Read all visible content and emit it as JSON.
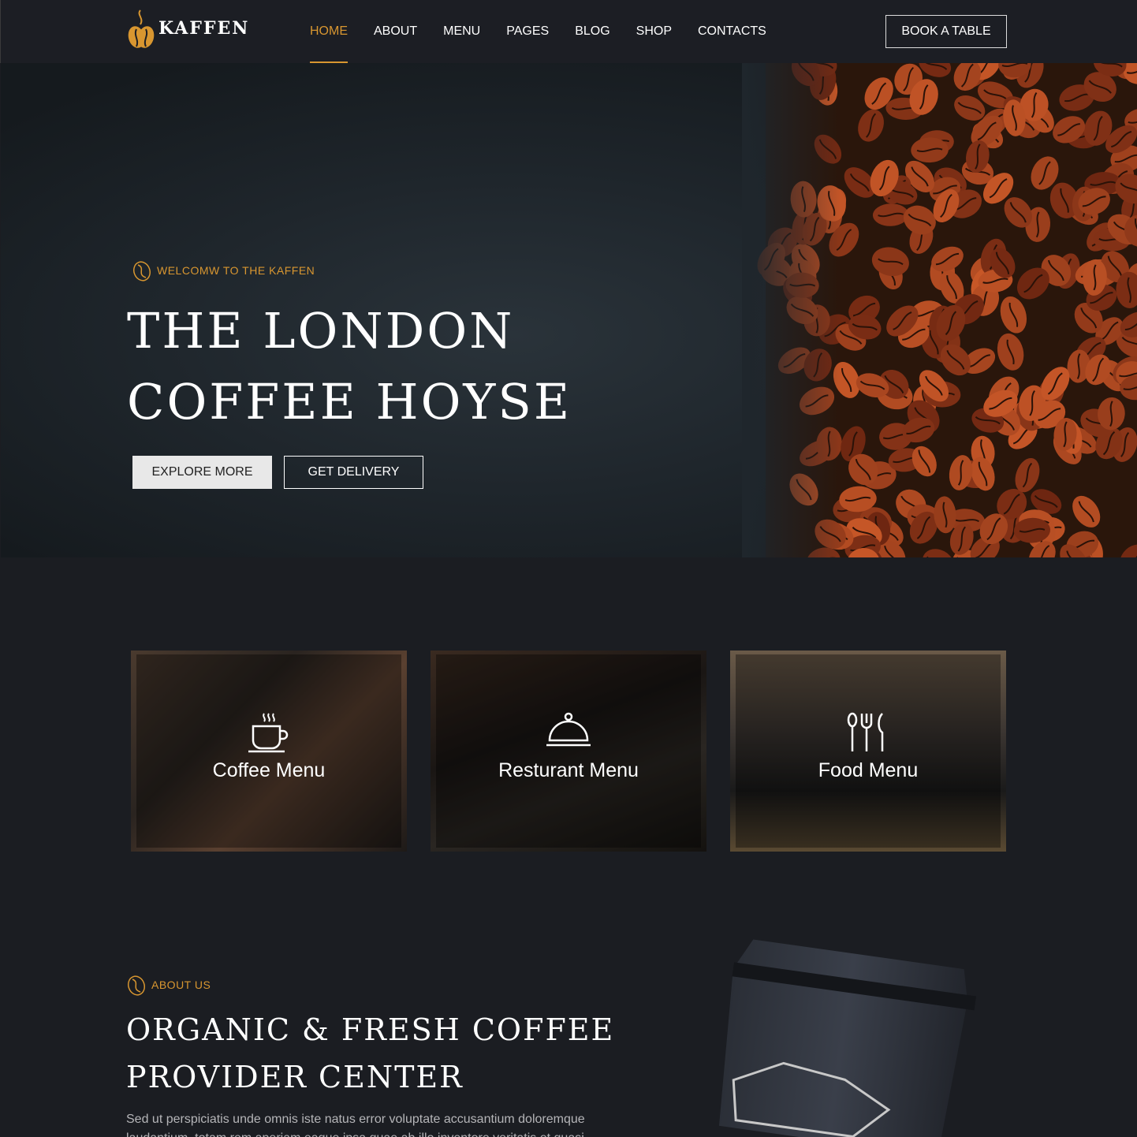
{
  "brand": {
    "name": "KAFFEN",
    "accent": "#d89630"
  },
  "nav": {
    "items": [
      {
        "label": "HOME",
        "active": true
      },
      {
        "label": "ABOUT"
      },
      {
        "label": "MENU"
      },
      {
        "label": "PAGES"
      },
      {
        "label": "BLOG"
      },
      {
        "label": "SHOP"
      },
      {
        "label": "CONTACTS"
      }
    ],
    "cta": "BOOK A TABLE"
  },
  "hero": {
    "welcome": "WELCOMW TO THE KAFFEN",
    "title_line1": "The London",
    "title_line2": "Coffee Hoyse",
    "btn_primary": "EXPLORE MORE",
    "btn_secondary": "GET DELIVERY"
  },
  "cards": [
    {
      "label": "Coffee Menu",
      "icon": "coffee-cup-icon"
    },
    {
      "label": "Resturant Menu",
      "icon": "food-cloche-icon"
    },
    {
      "label": "Food Menu",
      "icon": "cutlery-icon"
    }
  ],
  "about": {
    "tag": "ABOUT US",
    "title_line1": "Organic & Fresh Coffee",
    "title_line2": "Provider Center",
    "text": "Sed ut perspiciatis unde omnis iste natus error voluptate accusantium doloremque laudantium, totam rem aperiam eaque ipsa quae ab illo inventore veritatis et quasi"
  }
}
